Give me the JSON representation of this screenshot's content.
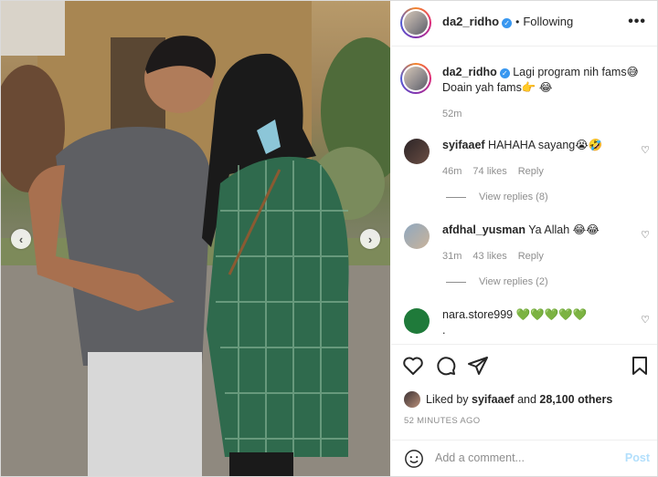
{
  "post": {
    "username": "da2_ridho",
    "follow_status": "Following",
    "more_icon": "more-options-icon",
    "caption": {
      "username": "da2_ridho",
      "text_line1": "Lagi program nih fams😅",
      "text_line2": "Doain yah fams👉 😂",
      "time": "52m"
    },
    "comments": [
      {
        "username": "syifaaef",
        "text": "HAHAHA sayang😭🤣",
        "time": "46m",
        "likes": "74 likes",
        "reply": "Reply",
        "view_replies": "View replies (8)"
      },
      {
        "username": "afdhal_yusman",
        "text": "Ya Allah 😂😂",
        "time": "31m",
        "likes": "43 likes",
        "reply": "Reply",
        "view_replies": "View replies (2)"
      },
      {
        "username": "nara.store999",
        "text": "💚💚💚💚💚",
        "text2": "."
      }
    ],
    "liked_by": {
      "prefix": "Liked by ",
      "user": "syifaaef",
      "middle": " and ",
      "others": "28,100 others"
    },
    "timestamp": "52 MINUTES AGO",
    "add_comment_placeholder": "Add a comment...",
    "post_button": "Post"
  },
  "colors": {
    "verified": "#3897f0",
    "post_button_disabled": "#b2dffc",
    "secondary_text": "#8e8e8e"
  }
}
